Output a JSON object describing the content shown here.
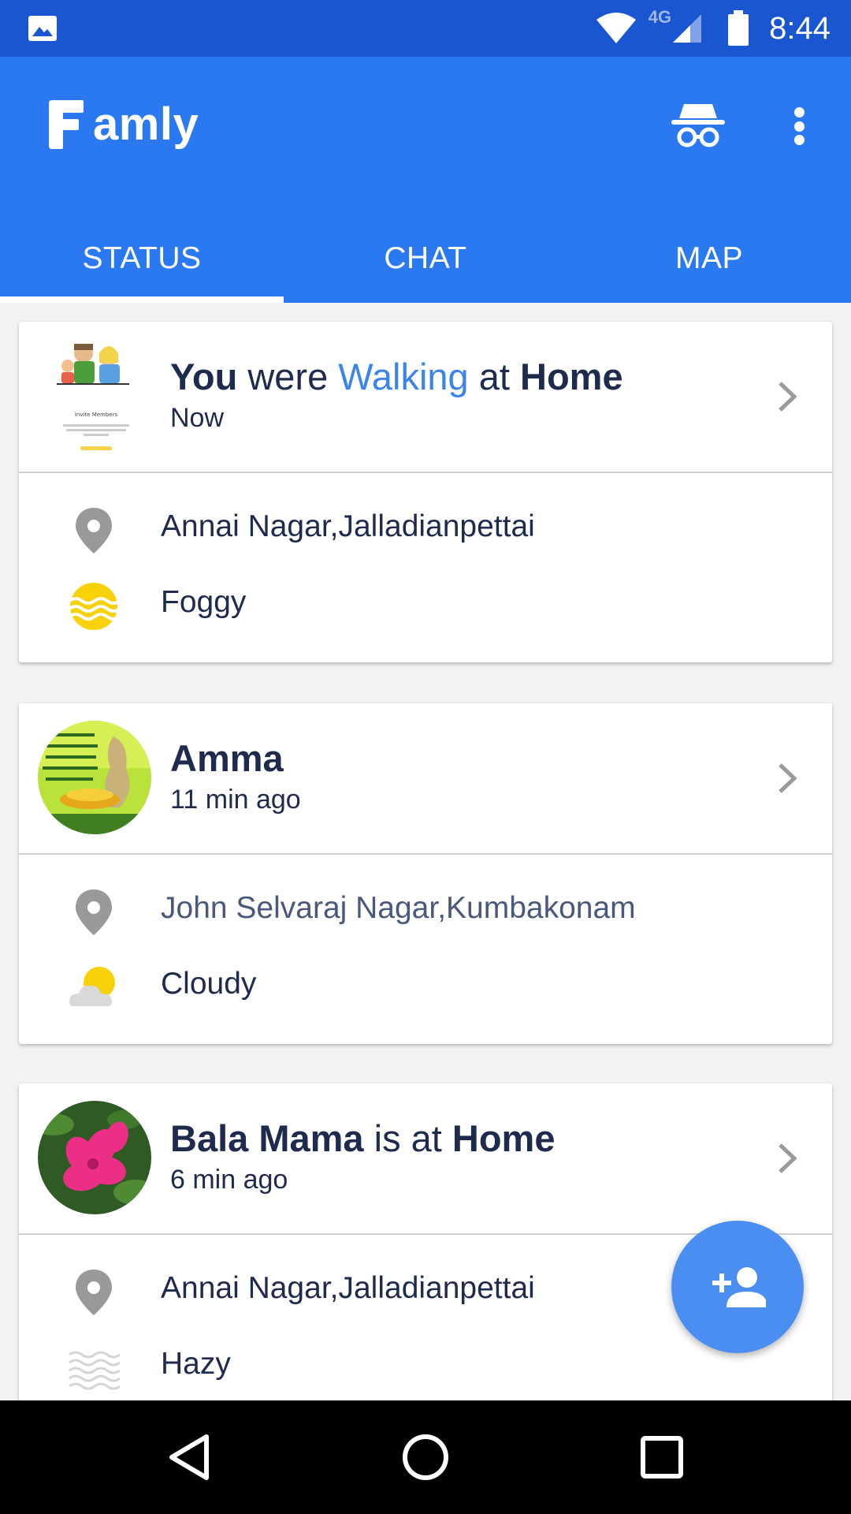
{
  "status_bar": {
    "time": "8:44",
    "network": "4G"
  },
  "app": {
    "logo_letter": "F",
    "logo_rest": "amly"
  },
  "tabs": [
    {
      "label": "STATUS",
      "active": true
    },
    {
      "label": "CHAT",
      "active": false
    },
    {
      "label": "MAP",
      "active": false
    }
  ],
  "cards": [
    {
      "name": "You",
      "verb": " were ",
      "activity": "Walking",
      "prep": " at ",
      "place": "Home",
      "time": "Now",
      "location": "Annai Nagar,Jalladianpettai",
      "weather": "Foggy",
      "weather_icon": "fog-sun-icon",
      "avatar_text": "Invite Members"
    },
    {
      "name": "Amma",
      "time": "11 min ago",
      "location": "John Selvaraj Nagar,Kumbakonam",
      "weather": "Cloudy",
      "weather_icon": "partly-cloudy-icon"
    },
    {
      "name": "Bala Mama",
      "verb": " is at ",
      "place": "Home",
      "time": "6 min ago",
      "location": "Annai Nagar,Jalladianpettai",
      "weather": "Hazy",
      "weather_icon": "haze-icon"
    }
  ],
  "colors": {
    "primary": "#2b79f0",
    "status_bar": "#1a56cf",
    "accent": "#3b84ea",
    "fab": "#4a8ef1"
  }
}
